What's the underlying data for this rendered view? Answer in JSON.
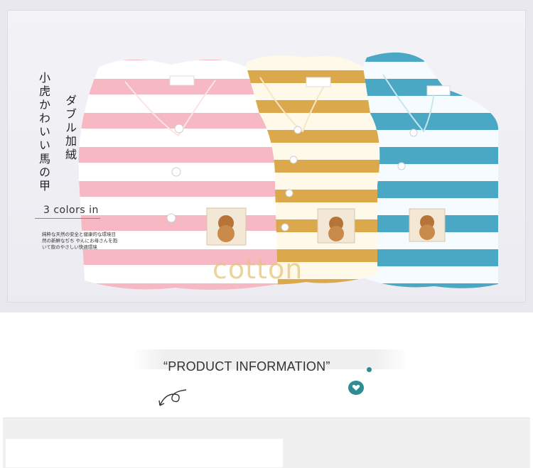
{
  "hero": {
    "jp_title_1": "小虎かわいい馬の甲",
    "jp_title_2": "ダブル加絨",
    "colors_label": "3 colors in",
    "small_copy": "純粋な天然の安全と健康的な環境日然の新鮮なぢち やんにお母さんを抱いて飲のやさしい快適環境",
    "watermark": "cotton",
    "vest_colors": [
      "#f3a5b4",
      "#e2b35f",
      "#5eb8cc"
    ]
  },
  "section": {
    "title": "“PRODUCT INFORMATION”",
    "accent_color": "#2f8b94",
    "icons": [
      "heart-icon",
      "swirl-arrow-icon"
    ]
  }
}
